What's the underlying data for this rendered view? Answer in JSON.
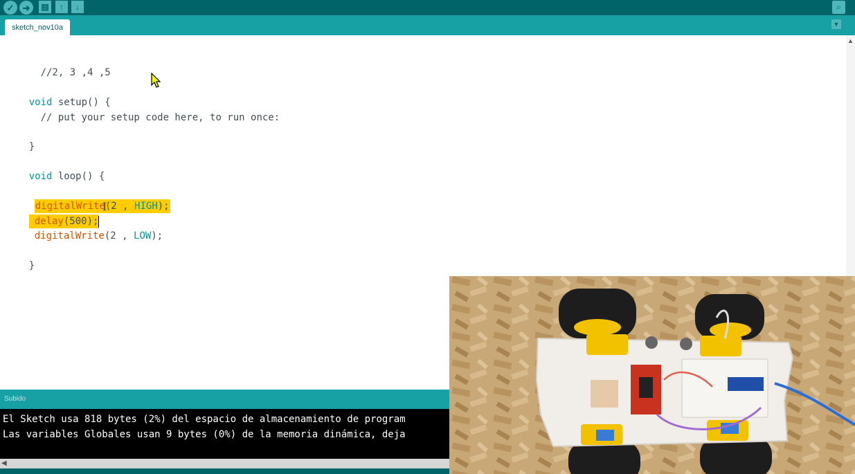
{
  "toolbar": {
    "verify_icon": "checkmark-icon",
    "upload_icon": "arrow-right-icon",
    "new_icon": "file-icon",
    "open_icon": "arrow-up-icon",
    "save_icon": "arrow-down-icon",
    "serial_monitor_icon": "magnifier-icon"
  },
  "tabs": [
    {
      "label": "sketch_nov10a"
    }
  ],
  "editor": {
    "lines": [
      "//2, 3 ,4 ,5",
      "void setup() {",
      "  // put your setup code here, to run once:",
      "}",
      "void loop() {",
      "digitalWrite(2 , HIGH);",
      "delay(500);",
      "digitalWrite(2 , LOW);",
      "}"
    ],
    "l0": "  //2, 3 ,4 ,5",
    "l1_kw": "void",
    "l1_fn": " setup",
    "l1_rest": "() {",
    "l2": "  // put your setup code here, to run once:",
    "l3": "}",
    "l4_kw": "void",
    "l4_fn": " loop",
    "l4_rest": "() {",
    "l5_fn": "digitalWrite",
    "l5_a": "(2 , ",
    "l5_c": "HIGH",
    "l5_b": ");",
    "l6_fn": "delay",
    "l6_rest": "(500);",
    "l7_fn": "digitalWrite",
    "l7_a": "(2 , ",
    "l7_c": "LOW",
    "l7_b": ");",
    "l8": "}"
  },
  "status": {
    "text": "Subido"
  },
  "console": {
    "lines": [
      "El Sketch usa 818 bytes (2%) del espacio de almacenamiento de program",
      "Las variables Globales usan 9 bytes (0%) de la memoria dinámica, deja"
    ]
  },
  "colors": {
    "toolbar": "#006468",
    "tabbar": "#17a1a5",
    "highlight": "#ffcc00",
    "keyword": "#00979c",
    "function": "#d35400"
  },
  "video": {
    "description_icon": "webcam-robot-car-image"
  }
}
